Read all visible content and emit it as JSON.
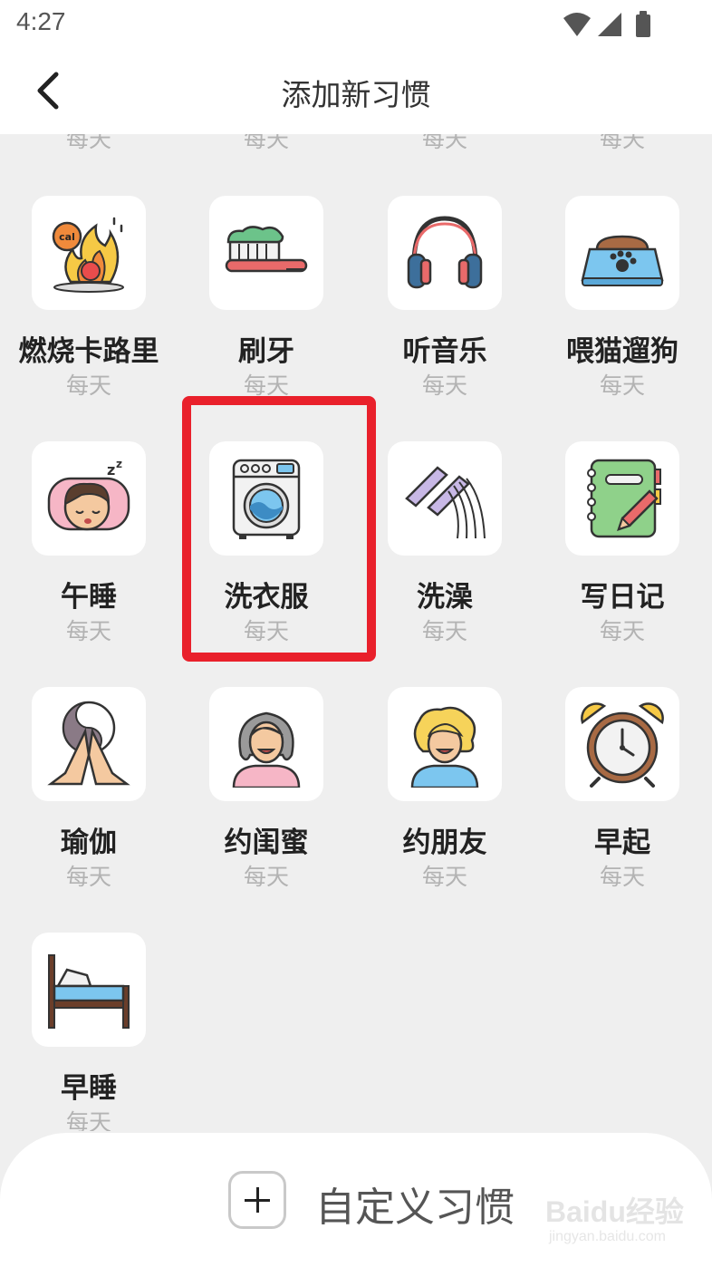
{
  "status_bar": {
    "time": "4:27"
  },
  "header": {
    "title": "添加新习惯"
  },
  "partial_row": {
    "frequency": [
      "每天",
      "每天",
      "每天",
      "每天"
    ]
  },
  "habits": [
    {
      "name": "燃烧卡路里",
      "frequency": "每天",
      "icon": "calorie-fire-icon",
      "icon_text": "cal"
    },
    {
      "name": "刷牙",
      "frequency": "每天",
      "icon": "toothbrush-icon"
    },
    {
      "name": "听音乐",
      "frequency": "每天",
      "icon": "headphones-icon"
    },
    {
      "name": "喂猫遛狗",
      "frequency": "每天",
      "icon": "pet-bowl-icon"
    },
    {
      "name": "午睡",
      "frequency": "每天",
      "icon": "nap-icon"
    },
    {
      "name": "洗衣服",
      "frequency": "每天",
      "icon": "washing-machine-icon",
      "highlighted": true
    },
    {
      "name": "洗澡",
      "frequency": "每天",
      "icon": "shower-icon"
    },
    {
      "name": "写日记",
      "frequency": "每天",
      "icon": "diary-icon"
    },
    {
      "name": "瑜伽",
      "frequency": "每天",
      "icon": "yoga-icon"
    },
    {
      "name": "约闺蜜",
      "frequency": "每天",
      "icon": "girlfriend-icon"
    },
    {
      "name": "约朋友",
      "frequency": "每天",
      "icon": "friend-icon"
    },
    {
      "name": "早起",
      "frequency": "每天",
      "icon": "alarm-clock-icon"
    },
    {
      "name": "早睡",
      "frequency": "每天",
      "icon": "bed-icon"
    }
  ],
  "bottom": {
    "custom_label": "自定义习惯"
  },
  "watermark": {
    "logo": "Baidu经验",
    "url": "jingyan.baidu.com"
  },
  "colors": {
    "highlight": "#e9202b",
    "background": "#efefef",
    "subtext": "#b3b3b3"
  }
}
